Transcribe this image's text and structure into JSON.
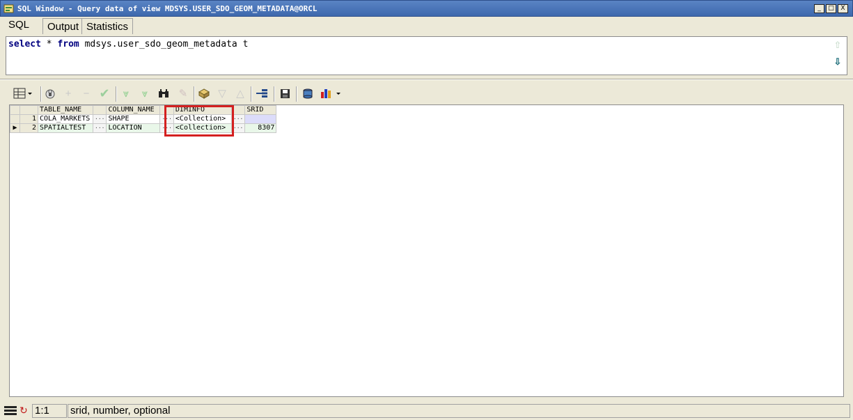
{
  "window": {
    "title": "SQL Window - Query data of view MDSYS.USER_SDO_GEOM_METADATA@ORCL",
    "buttons": {
      "minimize": "_",
      "restore": "□",
      "close": "X"
    }
  },
  "tabs": [
    {
      "label": "SQL"
    },
    {
      "label": "Output"
    },
    {
      "label": "Statistics"
    }
  ],
  "editor": {
    "kw_select": "select",
    "star": " * ",
    "kw_from": "from",
    "rest": " mdsys.user_sdo_geom_metadata t"
  },
  "grid": {
    "columns": [
      "TABLE_NAME",
      "COLUMN_NAME",
      "DIMINFO",
      "SRID"
    ],
    "rows": [
      {
        "num": "1",
        "table_name": "COLA_MARKETS",
        "column_name": "SHAPE",
        "diminfo": "<Collection>",
        "srid": ""
      },
      {
        "num": "2",
        "table_name": "SPATIALTEST",
        "column_name": "LOCATION",
        "diminfo": "<Collection>",
        "srid": "8307"
      }
    ],
    "ellipsis": "···"
  },
  "status": {
    "position": "1:1",
    "hint": "srid, number, optional"
  },
  "colors": {
    "title_bg": "#3d68ad",
    "highlight": "#d42020",
    "selected_row": "#e9f7e9"
  }
}
